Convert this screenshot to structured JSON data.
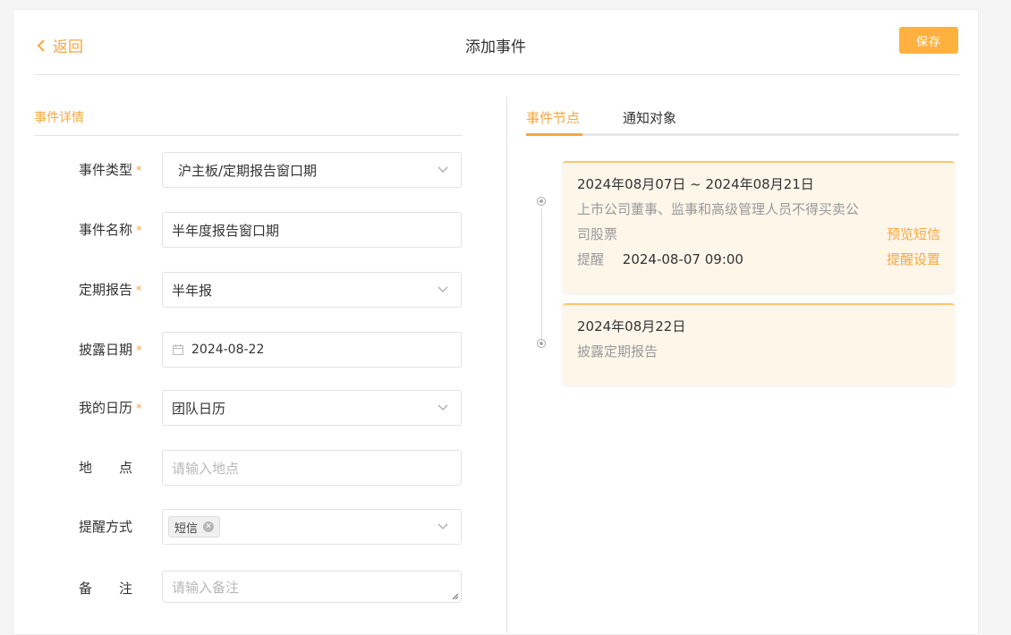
{
  "header": {
    "back_label": "返回",
    "title": "添加事件",
    "save_label": "保存"
  },
  "details": {
    "section_title": "事件详情",
    "fields": [
      {
        "label": "事件类型",
        "required": true,
        "value": "沪主板/定期报告窗口期",
        "type": "select"
      },
      {
        "label": "事件名称",
        "required": true,
        "value": "半年度报告窗口期",
        "type": "text"
      },
      {
        "label": "定期报告",
        "required": true,
        "value": "半年报",
        "type": "select"
      },
      {
        "label": "披露日期",
        "required": true,
        "value": "2024-08-22",
        "type": "date"
      },
      {
        "label": "我的日历",
        "required": true,
        "value": "团队日历",
        "type": "select"
      },
      {
        "label": "地　　点",
        "required": false,
        "placeholder": "请输入地点",
        "type": "text"
      },
      {
        "label": "提醒方式",
        "required": false,
        "tag": "短信",
        "type": "tag-select"
      },
      {
        "label": "备　　注",
        "required": false,
        "placeholder": "请输入备注",
        "type": "textarea"
      }
    ]
  },
  "tabs": [
    "事件节点",
    "通知对象"
  ],
  "timeline": [
    {
      "date": "2024年08月07日 ~ 2024年08月21日",
      "desc_line1": "上市公司董事、监事和高级管理人员不得买卖公",
      "desc_line2": "司股票",
      "preview_link": "预览短信",
      "remind_label": "提醒",
      "remind_time": "2024-08-07 09:00",
      "remind_link": "提醒设置"
    },
    {
      "date": "2024年08月22日",
      "desc": "披露定期报告"
    }
  ],
  "colors": {
    "accent": "#f5a742",
    "save_button": "#ffb13f",
    "card_bg": "#fff6ea",
    "card_border": "#ffc46a"
  }
}
